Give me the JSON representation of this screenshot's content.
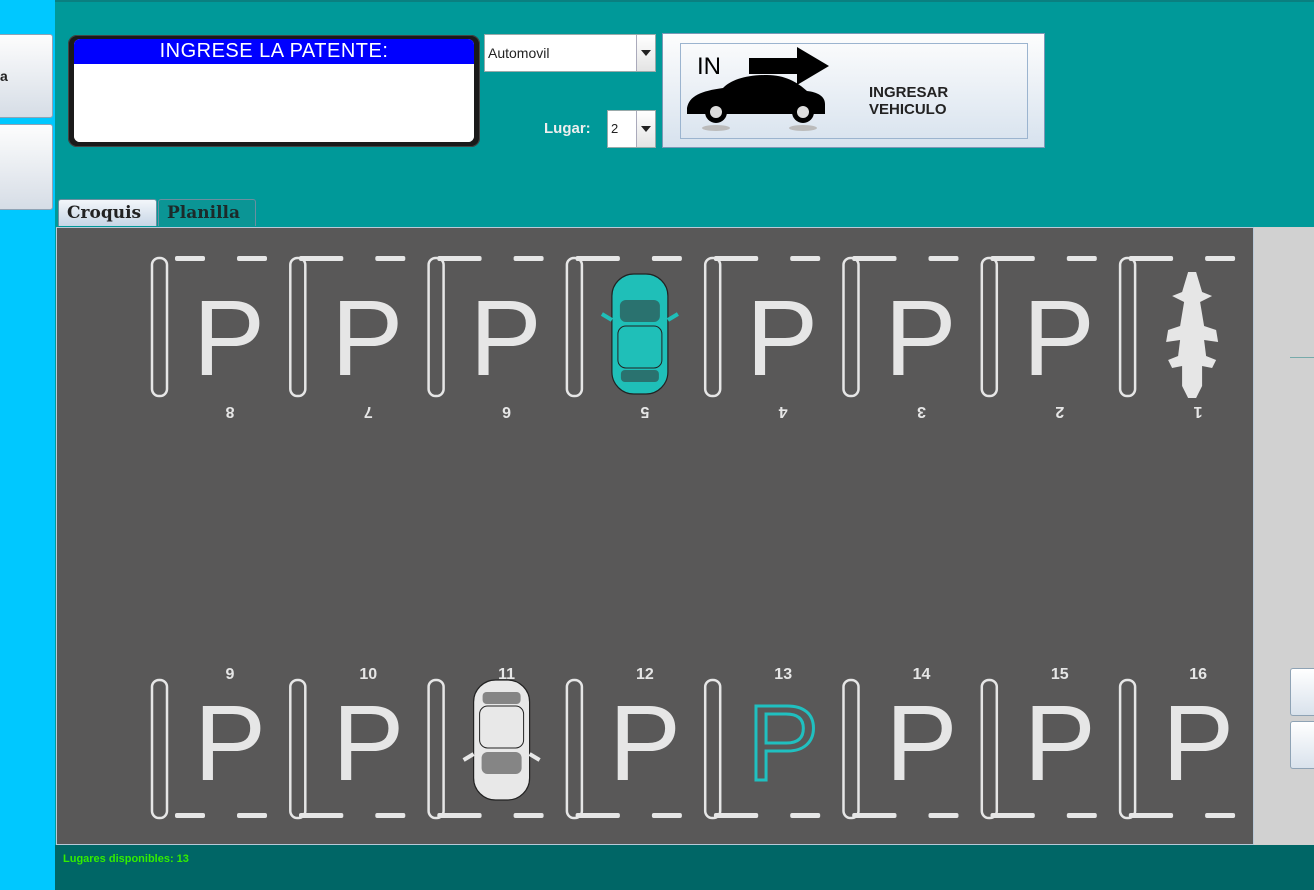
{
  "left_panel": {
    "button1_label": "a"
  },
  "patente": {
    "title": "INGRESE LA PATENTE:",
    "value": ""
  },
  "vehicle_type": {
    "selected": "Automovil"
  },
  "lugar": {
    "label": "Lugar:",
    "selected": "2"
  },
  "ingresar": {
    "icon_text": "IN",
    "label": "INGRESAR VEHICULO"
  },
  "tabs": [
    {
      "label": "Croquis"
    },
    {
      "label": "Planilla"
    }
  ],
  "spots_top": [
    {
      "number": "8",
      "state": "free"
    },
    {
      "number": "7",
      "state": "free"
    },
    {
      "number": "6",
      "state": "free"
    },
    {
      "number": "5",
      "state": "car",
      "car_color": "#1fbfb8"
    },
    {
      "number": "4",
      "state": "free"
    },
    {
      "number": "3",
      "state": "free"
    },
    {
      "number": "2",
      "state": "free"
    },
    {
      "number": "1",
      "state": "motorcycle"
    }
  ],
  "spots_bottom": [
    {
      "number": "9",
      "state": "free"
    },
    {
      "number": "10",
      "state": "free"
    },
    {
      "number": "11",
      "state": "car",
      "car_color": "#e8e8e8"
    },
    {
      "number": "12",
      "state": "free"
    },
    {
      "number": "13",
      "state": "selected"
    },
    {
      "number": "14",
      "state": "free"
    },
    {
      "number": "15",
      "state": "free"
    },
    {
      "number": "16",
      "state": "free"
    }
  ],
  "parking_letter": "P",
  "colors": {
    "lot": "#595858",
    "marking": "#e6e6e6",
    "selected": "#20c0c0",
    "background": "#009999"
  },
  "status": {
    "text": "Lugares disponibles: 13"
  }
}
